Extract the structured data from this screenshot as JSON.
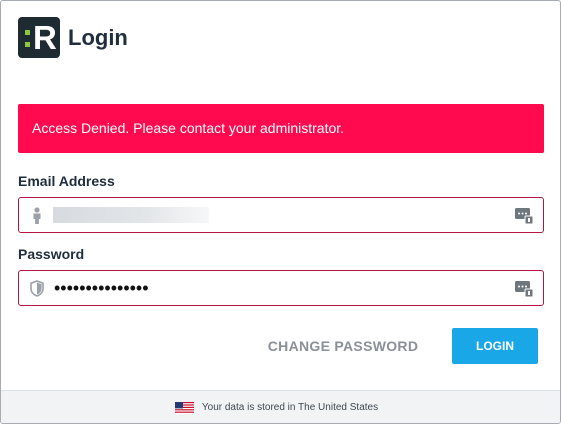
{
  "header": {
    "logo_glyph": "R",
    "title": "Login"
  },
  "alert": {
    "message": "Access Denied. Please contact your administrator."
  },
  "form": {
    "email_label": "Email Address",
    "email_icon": "person-icon",
    "password_label": "Password",
    "password_icon": "shield-icon",
    "password_value": "•••••••••••••••",
    "autofill_icon": "password-manager-key-icon"
  },
  "actions": {
    "change_password_label": "CHANGE PASSWORD",
    "login_label": "LOGIN"
  },
  "footer": {
    "flag_icon": "us-flag-icon",
    "text": "Your data is stored in The United States"
  },
  "colors": {
    "alert_bg": "#ff0a4f",
    "field_error_border": "#b5153e",
    "login_button": "#1aa7e8",
    "logo_bg": "#1f2b33",
    "logo_accent": "#8dc63f"
  }
}
